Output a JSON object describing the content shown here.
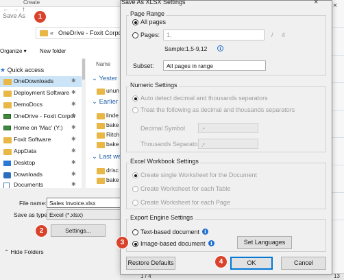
{
  "background_window": {
    "topbar_label": "Create",
    "title": "Save As",
    "nav": {
      "back": "←",
      "forward": "→",
      "up": "↑",
      "chevron": "«",
      "path": "OneDrive - Foxit Corporat"
    },
    "commands": {
      "organize": "Organize ▾",
      "new_folder": "New folder"
    },
    "quick_access": "Quick access",
    "sidebar_items": [
      {
        "label": "OneDownloads",
        "icon": "folder-icon",
        "pinned": true,
        "selected": true
      },
      {
        "label": "Deployment Software",
        "icon": "folder-icon",
        "pinned": true
      },
      {
        "label": "DemoDocs",
        "icon": "folder-icon",
        "pinned": true
      },
      {
        "label": "OneDrive - Foxit Corpor",
        "icon": "drive-icon",
        "pinned": true
      },
      {
        "label": "Home on 'Mac' (Y:)",
        "icon": "drive-icon",
        "pinned": true
      },
      {
        "label": "Foxit Software",
        "icon": "folder-icon",
        "pinned": true
      },
      {
        "label": "AppData",
        "icon": "folder-icon",
        "pinned": true
      },
      {
        "label": "Desktop",
        "icon": "desktop-icon",
        "pinned": true
      },
      {
        "label": "Downloads",
        "icon": "downloads-icon",
        "pinned": true
      },
      {
        "label": "Documents",
        "icon": "documents-icon",
        "pinned": true
      }
    ],
    "pin_glyph": "✱",
    "column_name": "Name",
    "groups": [
      {
        "label": "Yester",
        "files": [
          "unun"
        ]
      },
      {
        "label": "Earlier",
        "files": [
          "linde",
          "bake",
          "Ritch",
          "bake"
        ]
      },
      {
        "label": "Last we",
        "files": [
          "drisc",
          "bake"
        ]
      }
    ],
    "file_name_label": "File name:",
    "file_name_value": "Sales Invoice.xlsx",
    "save_type_label": "Save as type:",
    "save_type_value": "Excel (*.xlsx)",
    "settings_button": "Settings...",
    "hide_folders": "Hide Folders",
    "status_page": "1 / 4",
    "status_num": "13"
  },
  "dialog": {
    "title": "Save As XLSX Settings",
    "close": "×",
    "page_range": {
      "label": "Page Range",
      "all_pages": "All pages",
      "pages": "Pages:",
      "pages_value": "1,",
      "pages_slash": "/",
      "pages_total": "4",
      "sample": "Sample:1,5-9,12",
      "subset_label": "Subset:",
      "subset_value": "All pages in range"
    },
    "numeric": {
      "label": "Numeric Settings",
      "auto": "Auto detect decimal and thousands separators",
      "treat": "Treat the following as decimal and thousands separators",
      "decimal_label": "Decimal Symbol",
      "decimal_value": ".",
      "thousands_label": "Thousands Separator",
      "thousands_value": ","
    },
    "workbook": {
      "label": "Excel Workbook Settings",
      "single": "Create single Worksheet for the Document",
      "each_table": "Create Worksheet for each Table",
      "each_page": "Create Worksheet for each Page"
    },
    "engine": {
      "label": "Export Engine Settings",
      "text_based": "Text-based document",
      "image_based": "Image-based document",
      "set_languages": "Set Languages"
    },
    "restore_defaults": "Restore Defaults",
    "ok": "OK",
    "cancel": "Cancel",
    "info_glyph": "i",
    "chevron_glyph": "⌄"
  },
  "markers": [
    "1",
    "2",
    "3",
    "4"
  ],
  "colors": {
    "marker": "#d9432c",
    "accent": "#0078d7",
    "link": "#1e5fa8"
  }
}
